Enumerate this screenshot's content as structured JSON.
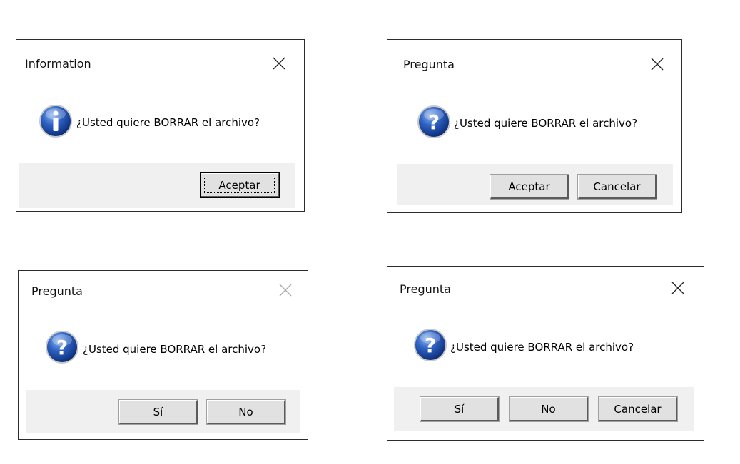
{
  "icons": {
    "info": "info-icon",
    "question": "question-icon",
    "close": "close-icon"
  },
  "colors": {
    "dialog_bg": "#ffffff",
    "button_bar_bg": "#f0f0f0",
    "button_face": "#e1e1e1",
    "icon_blue": "#1d4fa8",
    "close_disabled": "#a8a8a8"
  },
  "dialogs": [
    {
      "title": "Information",
      "icon": "info-icon",
      "message": "¿Usted quiere BORRAR el archivo?",
      "close_enabled": true,
      "buttons": [
        {
          "label": "Aceptar",
          "default": true
        }
      ]
    },
    {
      "title": "Pregunta",
      "icon": "question-icon",
      "message": "¿Usted quiere BORRAR el archivo?",
      "close_enabled": true,
      "buttons": [
        {
          "label": "Aceptar"
        },
        {
          "label": "Cancelar"
        }
      ]
    },
    {
      "title": "Pregunta",
      "icon": "question-icon",
      "message": "¿Usted quiere BORRAR el archivo?",
      "close_enabled": false,
      "buttons": [
        {
          "label": "Sí"
        },
        {
          "label": "No"
        }
      ]
    },
    {
      "title": "Pregunta",
      "icon": "question-icon",
      "message": "¿Usted quiere BORRAR el archivo?",
      "close_enabled": true,
      "buttons": [
        {
          "label": "Sí"
        },
        {
          "label": "No"
        },
        {
          "label": "Cancelar"
        }
      ]
    }
  ]
}
